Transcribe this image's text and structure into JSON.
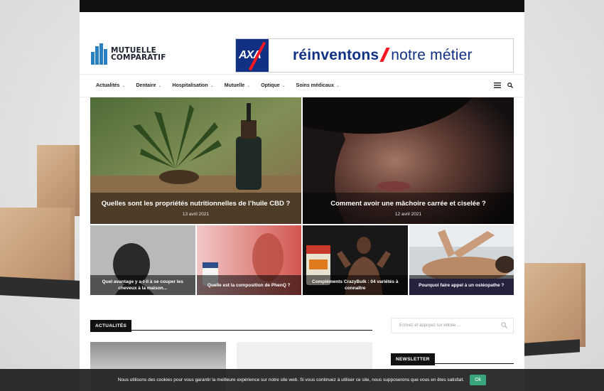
{
  "header": {
    "logo_line1": "MUTUELLE",
    "logo_line2": "COMPARATIF",
    "logo_color": "#2a7fc1",
    "banner": {
      "brand": "AXA",
      "bold_text": "réinventons",
      "text": "notre métier",
      "brand_color": "#103184",
      "slash_color": "#ff1721"
    }
  },
  "nav": {
    "items": [
      {
        "label": "Actualités"
      },
      {
        "label": "Dentaire"
      },
      {
        "label": "Hospitalisation"
      },
      {
        "label": "Mutuelle"
      },
      {
        "label": "Optique"
      },
      {
        "label": "Soins médicaux"
      }
    ],
    "menu_icon": "hamburger-icon",
    "search_icon": "search-icon"
  },
  "featured": [
    {
      "title": "Quelles sont les propriétés nutritionnelles de l’huile CBD ?",
      "date": "13 avril 2021"
    },
    {
      "title": "Comment avoir une mâchoire carrée et ciselée ?",
      "date": "12 avril 2021"
    }
  ],
  "small_posts": [
    {
      "title": "Quel avantage y a-t-il à se couper les cheveux à la maison..."
    },
    {
      "title": "Quelle est la composition de PhenQ ?"
    },
    {
      "title": "Compléments CrazyBulk : 04 variétés à connaître"
    },
    {
      "title": "Pourquoi faire appel à un ostéopathe ?"
    }
  ],
  "section": {
    "label": "ACTUALITÉS"
  },
  "sidebar": {
    "search_placeholder": "Ecrivez et appuyez sur entrée ...",
    "newsletter_label": "NEWSLETTER"
  },
  "cookie": {
    "message": "Nous utilisons des cookies pour vous garantir la meilleure expérience sur notre site web. Si vous continuez à utiliser ce site, nous supposerons que vous en êtes satisfait.",
    "ok_label": "Ok",
    "ok_color": "#3aa47c"
  }
}
